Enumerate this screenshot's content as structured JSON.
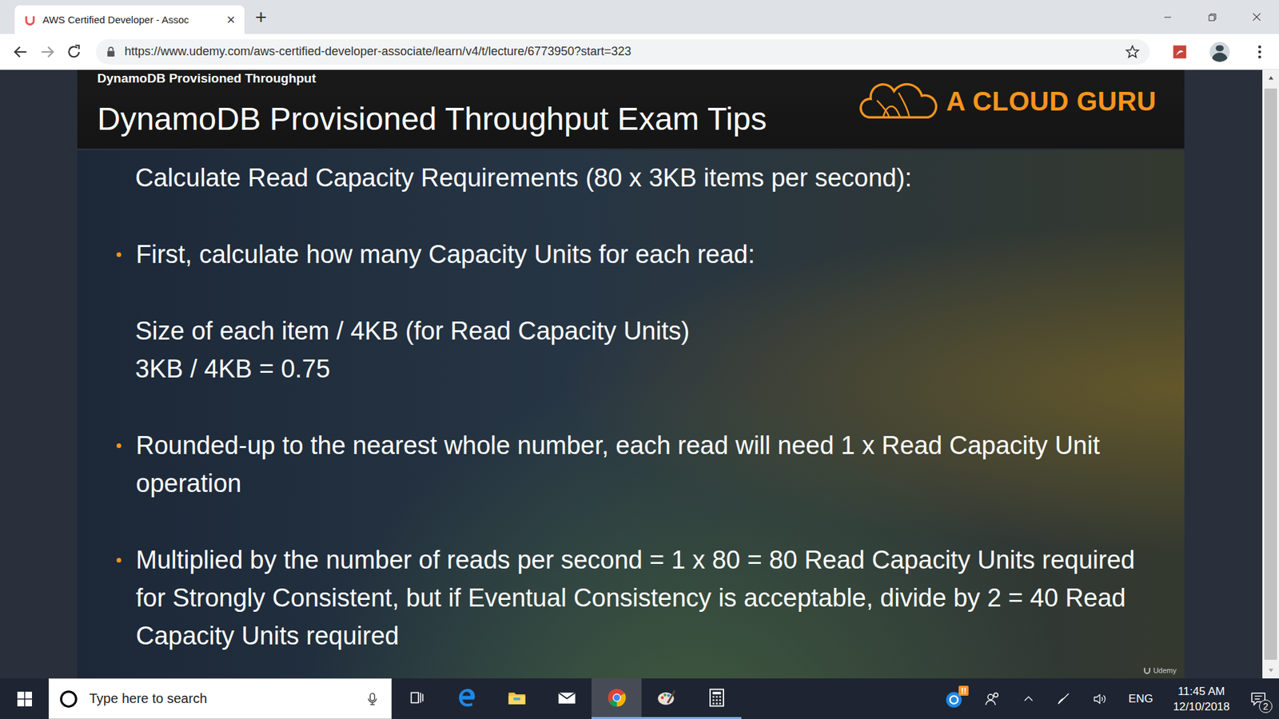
{
  "browser": {
    "tabs": [
      {
        "label": "AWS Certified Developer - Assoc",
        "selected": true,
        "close": "×"
      }
    ],
    "new_tab": "+",
    "url": "https://www.udemy.com/aws-certified-developer-associate/learn/v4/t/lecture/6773950?start=323",
    "bookmarked": false
  },
  "slide": {
    "section": "DynamoDB Provisioned Throughput",
    "title": "DynamoDB Provisioned Throughput Exam Tips",
    "logo": "A CLOUD GURU",
    "heading": "Calculate Read Capacity Requirements (80 x 3KB items per second):",
    "blocks": [
      {
        "kind": "bullet",
        "text": "First, calculate how many Capacity Units for each read:"
      },
      {
        "kind": "formula",
        "lines": [
          "Size of each item / 4KB (for Read Capacity Units)",
          "3KB / 4KB = 0.75"
        ]
      },
      {
        "kind": "bullet",
        "text": "Rounded-up to the nearest whole number, each read will need 1 x Read Capacity Unit operation"
      },
      {
        "kind": "bullet",
        "text": "Multiplied by the number of reads per second = 1 x 80 = 80 Read Capacity Units required for Strongly Consistent, but if Eventual Consistency is acceptable, divide by 2 = 40 Read Capacity Units required"
      }
    ],
    "watermark": "Udemy"
  },
  "taskbar": {
    "search": {
      "placeholder": "Type here to search"
    },
    "apps": [
      {
        "kind": "taskview",
        "selected": false,
        "open": false
      },
      {
        "kind": "edge",
        "selected": false,
        "open": false
      },
      {
        "kind": "explorer",
        "selected": false,
        "open": false
      },
      {
        "kind": "mail",
        "selected": false,
        "open": false
      },
      {
        "kind": "chrome",
        "selected": true,
        "open": true
      },
      {
        "kind": "paint",
        "selected": false,
        "open": true
      },
      {
        "kind": "calculator",
        "selected": false,
        "open": true
      }
    ],
    "tray": {
      "help_badge": "!!",
      "language": "ENG",
      "time": "11:45 AM",
      "date": "12/10/2018",
      "notifications": "2"
    }
  }
}
